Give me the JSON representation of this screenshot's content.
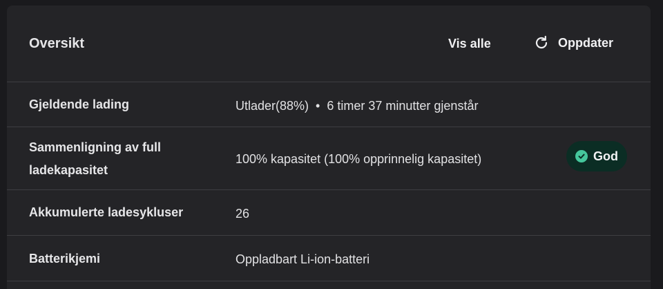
{
  "header": {
    "title": "Oversikt",
    "view_all_label": "Vis alle",
    "refresh_label": "Oppdater"
  },
  "rows": [
    {
      "label": "Gjeldende lading",
      "status": "Utlader(88%)",
      "separator": "•",
      "remaining": "6 timer 37 minutter gjenstår"
    },
    {
      "label_line1": "Sammenligning av full",
      "label_line2": "ladekapasitet",
      "value": "100% kapasitet (100% opprinnelig kapasitet)",
      "badge": "God",
      "badge_color": "#45c79c"
    },
    {
      "label": "Akkumulerte ladesykluser",
      "value": "26"
    },
    {
      "label": "Batterikjemi",
      "value": "Oppladbart Li-ion-batteri"
    }
  ],
  "icons": {
    "refresh": "refresh-icon",
    "check": "check-circle-icon"
  }
}
